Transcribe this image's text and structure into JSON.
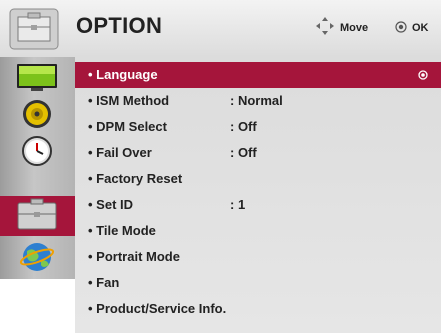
{
  "header": {
    "title": "OPTION",
    "move_label": "Move",
    "ok_label": "OK",
    "icon": "toolbox-icon"
  },
  "tabs": [
    {
      "name": "picture",
      "icon": "tv-icon"
    },
    {
      "name": "audio",
      "icon": "speaker-icon"
    },
    {
      "name": "time",
      "icon": "clock-icon"
    },
    {
      "name": "option",
      "icon": "toolbox-icon",
      "active": true
    },
    {
      "name": "network",
      "icon": "globe-icon"
    }
  ],
  "menu": {
    "items": [
      {
        "label": "• Language",
        "value": "",
        "selected": true
      },
      {
        "label": "• ISM Method",
        "value": ": Normal"
      },
      {
        "label": "• DPM Select",
        "value": ": Off"
      },
      {
        "label": "• Fail Over",
        "value": ": Off"
      },
      {
        "label": "• Factory Reset",
        "value": ""
      },
      {
        "label": "• Set ID",
        "value": ": 1"
      },
      {
        "label": "• Tile Mode",
        "value": ""
      },
      {
        "label": "• Portrait Mode",
        "value": ""
      },
      {
        "label": "• Fan",
        "value": ""
      },
      {
        "label": "• Product/Service Info.",
        "value": ""
      }
    ]
  },
  "colors": {
    "accent": "#a5153b",
    "panel": "#e0e0e0"
  }
}
